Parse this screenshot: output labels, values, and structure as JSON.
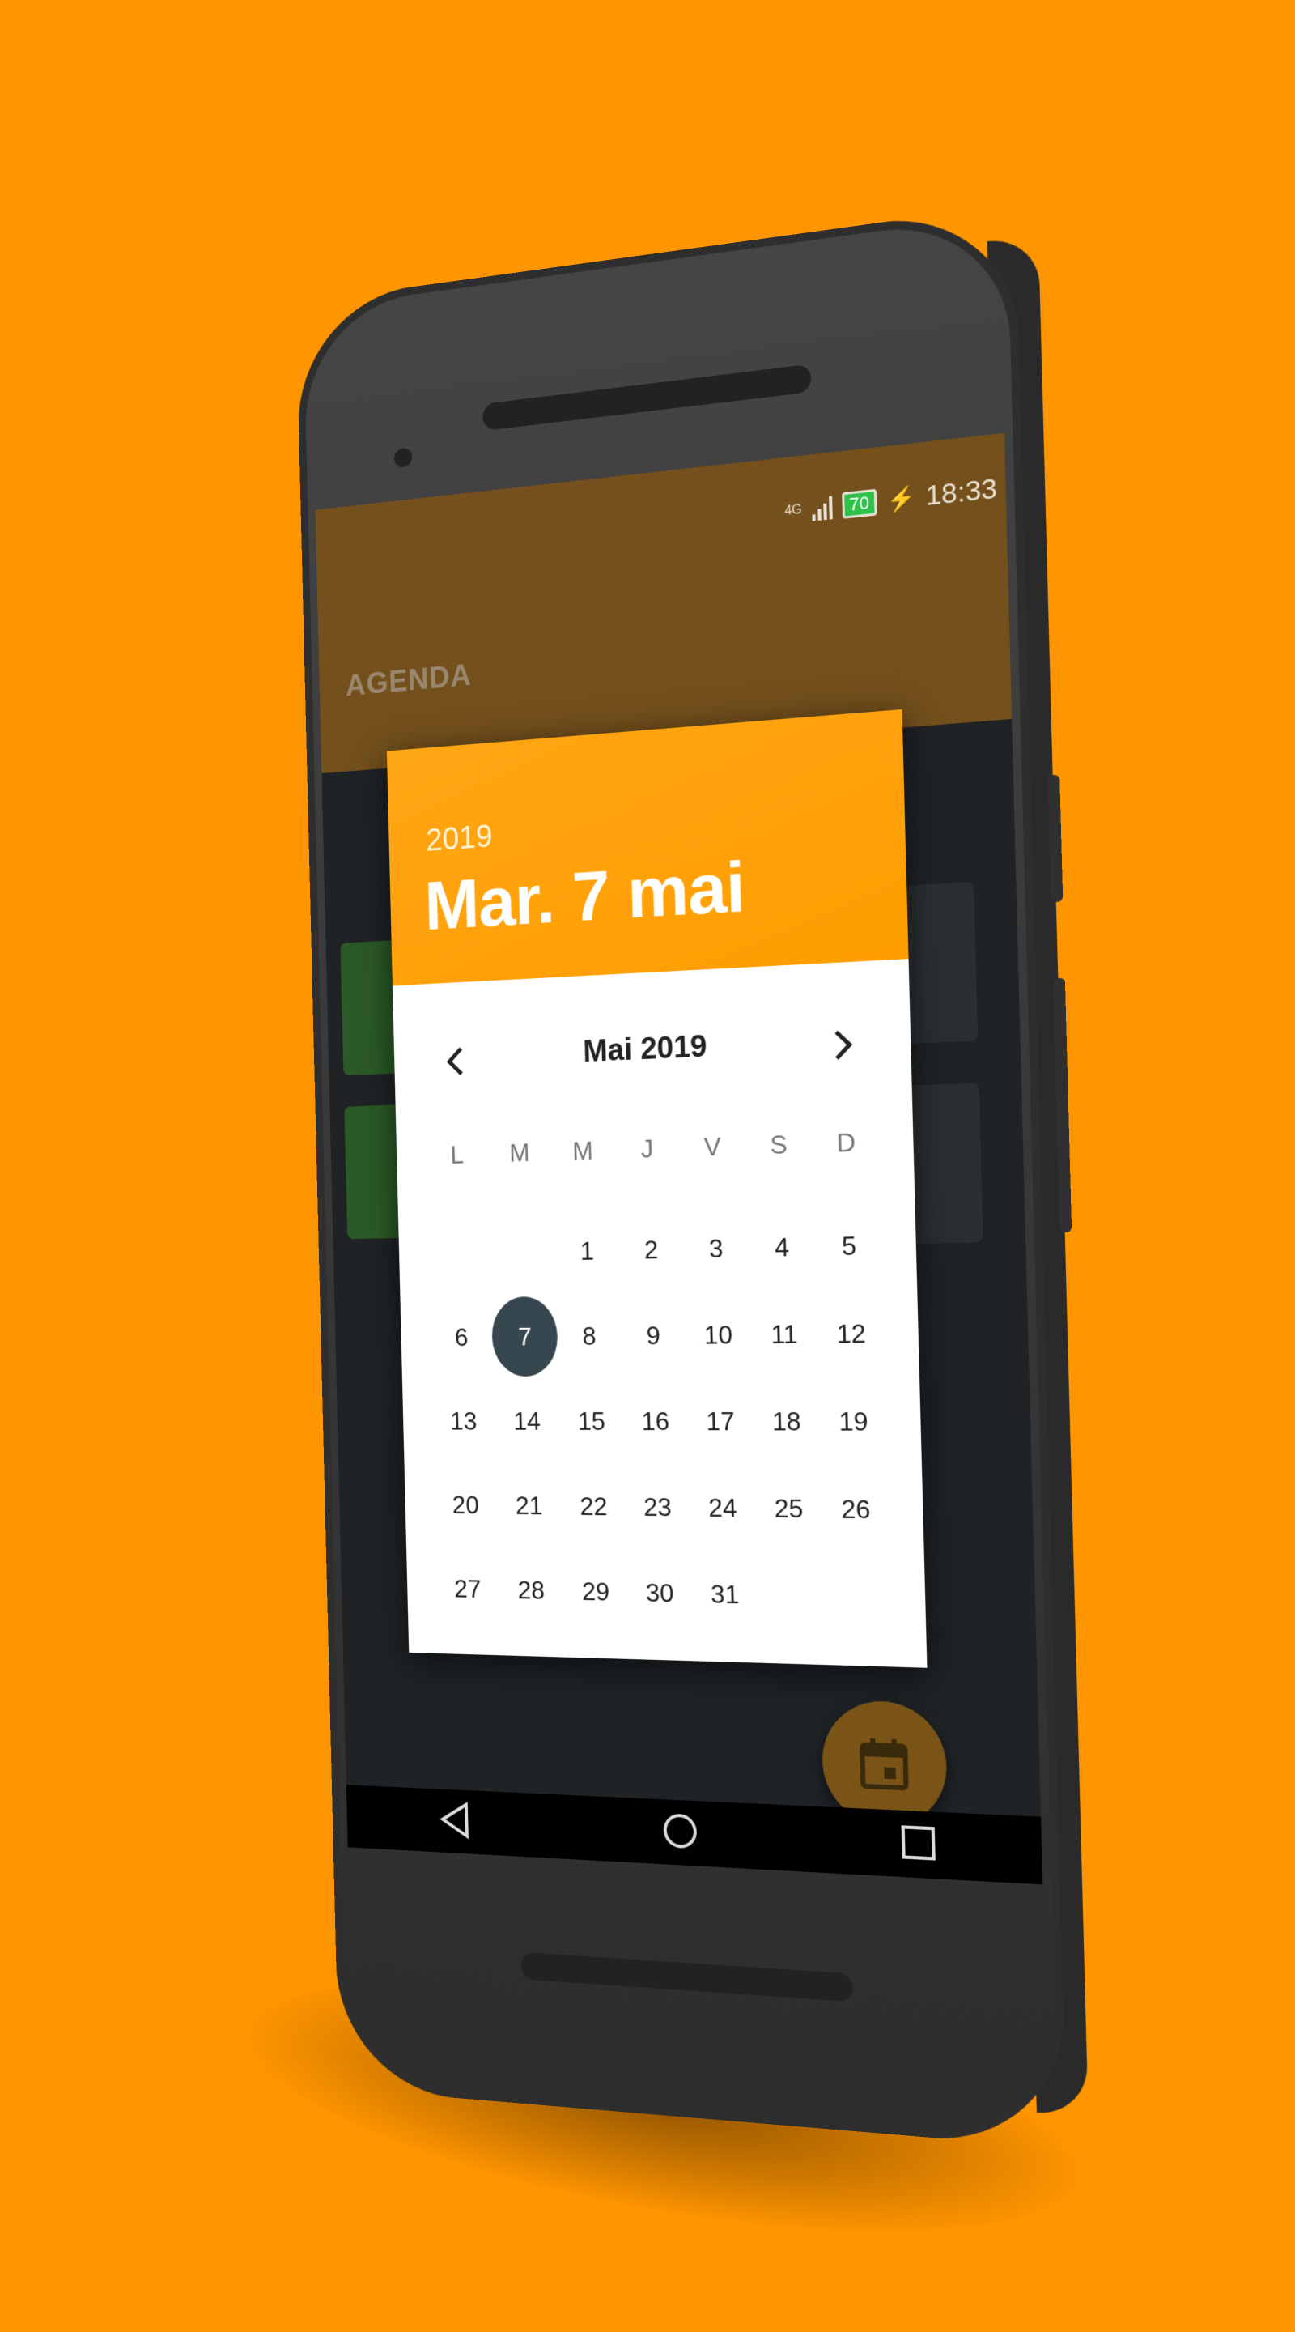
{
  "status_bar": {
    "network": "4G",
    "battery": "70",
    "time": "18:33"
  },
  "app": {
    "title": "AGENDA"
  },
  "date_picker": {
    "header_year": "2019",
    "header_date": "Mar. 7 mai",
    "month_label": "Mai 2019",
    "prev_icon": "chevron-left-icon",
    "next_icon": "chevron-right-icon",
    "weekdays": [
      "L",
      "M",
      "M",
      "J",
      "V",
      "S",
      "D"
    ],
    "days": [
      "",
      "",
      "1",
      "2",
      "3",
      "4",
      "5",
      "6",
      "7",
      "8",
      "9",
      "10",
      "11",
      "12",
      "13",
      "14",
      "15",
      "16",
      "17",
      "18",
      "19",
      "20",
      "21",
      "22",
      "23",
      "24",
      "25",
      "26",
      "27",
      "28",
      "29",
      "30",
      "31"
    ],
    "selected_day": "7",
    "selected_color": "#37474f",
    "accent_color": "#FFA615"
  },
  "fab": {
    "icon": "calendar-icon"
  },
  "nav_bar": {
    "back_icon": "back-triangle-icon",
    "home_icon": "home-circle-icon",
    "recents_icon": "recents-square-icon"
  },
  "background_color": "#FF9500"
}
